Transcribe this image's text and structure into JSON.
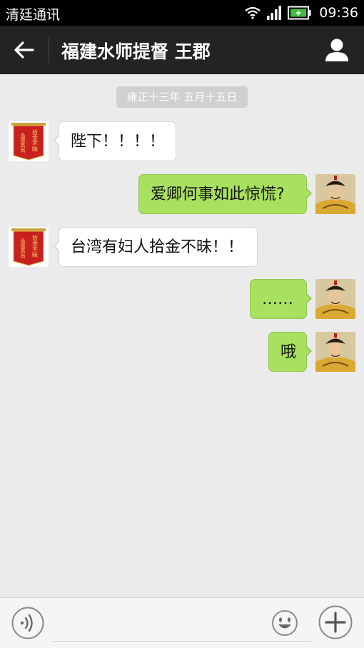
{
  "status_bar": {
    "carrier": "清廷通讯",
    "time": "09:36",
    "icons": [
      "wifi-icon",
      "signal-icon",
      "battery-charging-icon"
    ]
  },
  "nav": {
    "title": "福建水师提督 王郡",
    "icons": [
      "back-arrow-icon",
      "profile-icon"
    ]
  },
  "chat": {
    "timestamp": "雍正十三年 五月十五日",
    "messages": [
      {
        "side": "left",
        "text": "陛下！！！！"
      },
      {
        "side": "right",
        "text": "爱卿何事如此惊慌?"
      },
      {
        "side": "left",
        "text": "台湾有妇人拾金不昧！！"
      },
      {
        "side": "right",
        "text": "……"
      },
      {
        "side": "right",
        "text": "哦"
      }
    ],
    "avatar_left_banner": {
      "right_column": "拾金不昧",
      "left_column": "品德高尚"
    }
  },
  "input_bar": {
    "placeholder": "",
    "icons": [
      "voice-icon",
      "emoji-icon",
      "plus-icon"
    ]
  },
  "colors": {
    "status_bg": "#000000",
    "nav_bg": "#232323",
    "chat_bg": "#ebebeb",
    "bubble_right": "#a8e15f",
    "bubble_left": "#ffffff"
  }
}
